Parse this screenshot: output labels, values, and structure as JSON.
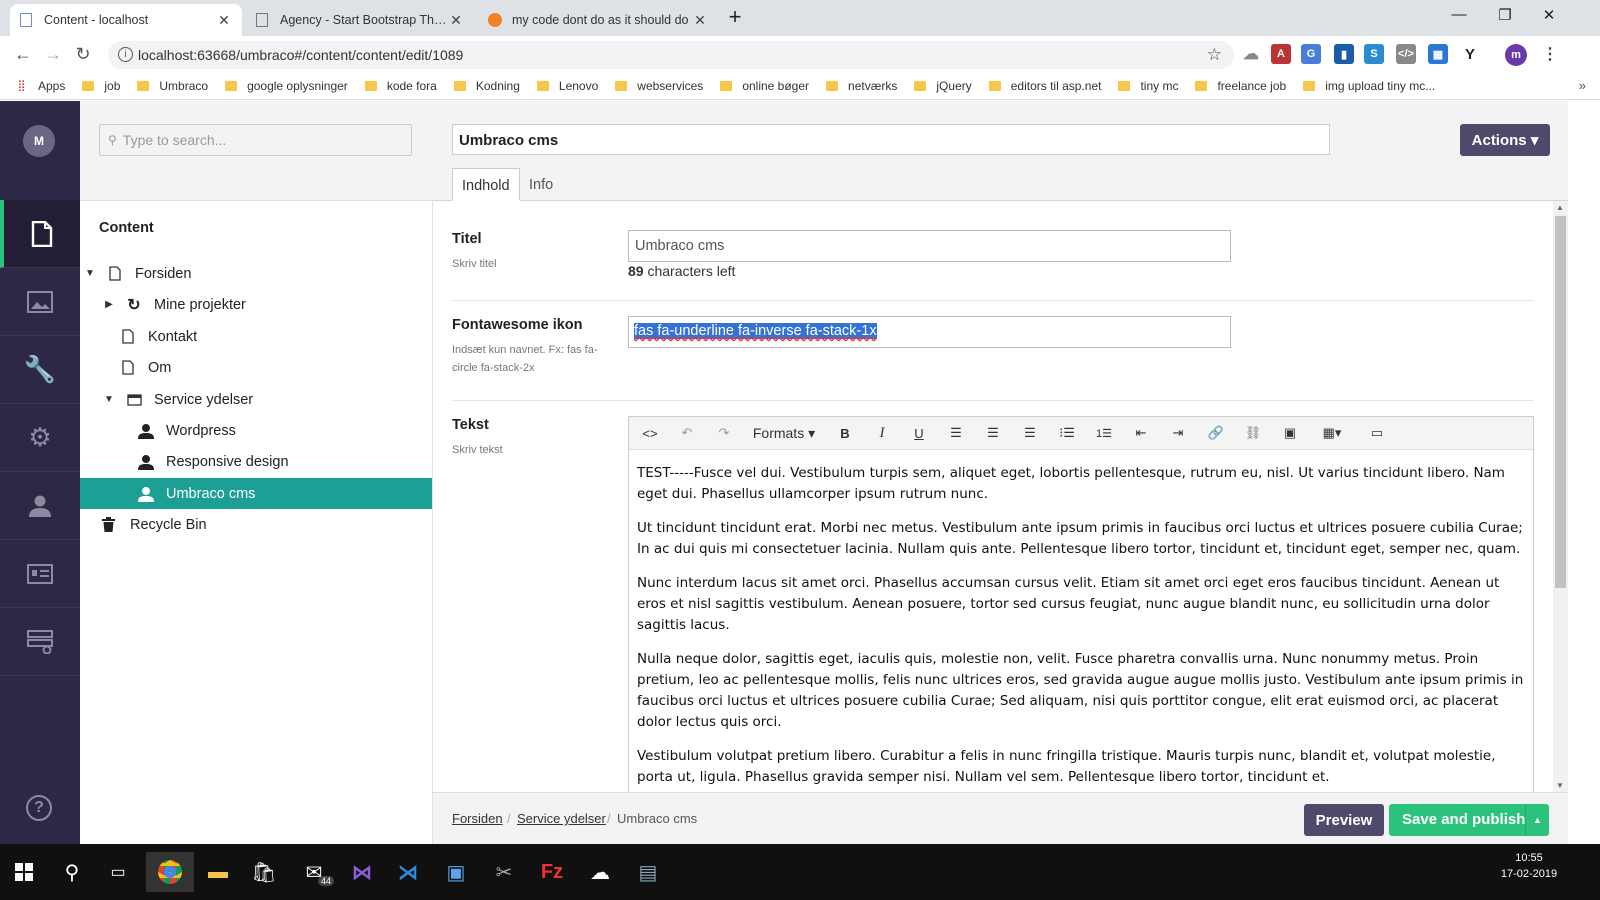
{
  "browser": {
    "tabs": [
      {
        "title": "Content - localhost",
        "active": true
      },
      {
        "title": "Agency - Start Bootstrap Theme",
        "active": false
      },
      {
        "title": "my code dont do as it should do",
        "active": false
      }
    ],
    "new_tab": "+",
    "url": "localhost:63668/umbraco#/content/content/edit/1089",
    "profile_initial": "m",
    "bookmarks": [
      "Apps",
      "job",
      "Umbraco",
      "google oplysninger",
      "kode fora",
      "Kodning",
      "Lenovo",
      "webservices",
      "online bøger",
      "netværks",
      "jQuery",
      "editors til asp.net",
      "tiny mc",
      "freelance job",
      "img upload tiny mc..."
    ]
  },
  "umbraco": {
    "user_initial": "M",
    "search_placeholder": "Type to search...",
    "tree_root": "Content",
    "tree": [
      {
        "label": "Forsiden",
        "icon": "document-icon"
      },
      {
        "label": "Mine projekter",
        "icon": "sync-icon"
      },
      {
        "label": "Kontakt",
        "icon": "document-icon"
      },
      {
        "label": "Om",
        "icon": "document-icon"
      },
      {
        "label": "Service ydelser",
        "icon": "window-icon"
      },
      {
        "label": "Wordpress",
        "icon": "user-icon"
      },
      {
        "label": "Responsive design",
        "icon": "user-icon"
      },
      {
        "label": "Umbraco cms",
        "icon": "user-icon"
      },
      {
        "label": "Recycle Bin",
        "icon": "trash-icon"
      }
    ],
    "node_name": "Umbraco cms",
    "actions_label": "Actions ▾",
    "tabs": [
      "Indhold",
      "Info"
    ],
    "fields": {
      "titel_label": "Titel",
      "titel_desc": "Skriv titel",
      "titel_value": "Umbraco cms",
      "chars_count": "89",
      "chars_suffix": " characters left",
      "icon_label": "Fontawesome ikon",
      "icon_desc": "Indsæt kun navnet. Fx: fas fa-circle fa-stack-2x",
      "icon_value": "fas fa-underline fa-inverse fa-stack-1x",
      "tekst_label": "Tekst",
      "tekst_desc": "Skriv tekst"
    },
    "rte_formats": "Formats ▾",
    "rte_paragraphs": [
      "TEST-----Fusce vel dui. Vestibulum turpis sem, aliquet eget, lobortis pellentesque, rutrum eu, nisl. Ut varius tincidunt libero. Nam eget dui. Phasellus ullamcorper ipsum rutrum nunc.",
      "Ut tincidunt tincidunt erat. Morbi nec metus. Vestibulum ante ipsum primis in faucibus orci luctus et ultrices posuere cubilia Curae; In ac dui quis mi consectetuer lacinia. Nullam quis ante. Pellentesque libero tortor, tincidunt et, tincidunt eget, semper nec, quam.",
      "Nunc interdum lacus sit amet orci. Phasellus accumsan cursus velit. Etiam sit amet orci eget eros faucibus tincidunt. Aenean ut eros et nisl sagittis vestibulum. Aenean posuere, tortor sed cursus feugiat, nunc augue blandit nunc, eu sollicitudin urna dolor sagittis lacus.",
      "Nulla neque dolor, sagittis eget, iaculis quis, molestie non, velit. Fusce pharetra convallis urna. Nunc nonummy metus. Proin pretium, leo ac pellentesque mollis, felis nunc ultrices eros, sed gravida augue augue mollis justo. Vestibulum ante ipsum primis in faucibus orci luctus et ultrices posuere cubilia Curae; Sed aliquam, nisi quis porttitor congue, elit erat euismod orci, ac placerat dolor lectus quis orci.",
      "Vestibulum volutpat pretium libero. Curabitur a felis in nunc fringilla tristique. Mauris turpis nunc, blandit et, volutpat molestie, porta ut, ligula. Phasellus gravida semper nisi. Nullam vel sem. Pellentesque libero tortor, tincidunt et."
    ],
    "breadcrumb": [
      "Forsiden",
      "Service ydelser",
      "Umbraco cms"
    ],
    "preview_label": "Preview",
    "publish_label": "Save and publish"
  },
  "taskbar": {
    "mail_badge": "44",
    "time": "10:55",
    "date": "17-02-2019"
  }
}
